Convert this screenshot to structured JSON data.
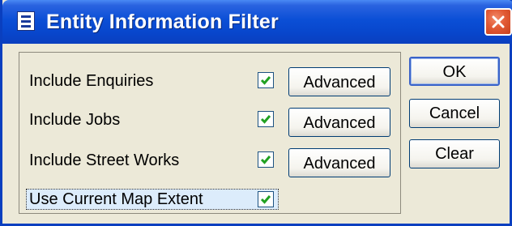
{
  "window": {
    "title": "Entity Information Filter",
    "title_icon": "form-icon",
    "close_icon": "close-icon"
  },
  "filters": [
    {
      "label": "Include Enquiries",
      "checked": true,
      "advanced_label": "Advanced"
    },
    {
      "label": "Include Jobs",
      "checked": true,
      "advanced_label": "Advanced"
    },
    {
      "label": "Include Street Works",
      "checked": true,
      "advanced_label": "Advanced"
    }
  ],
  "map_extent": {
    "label": "Use Current Map Extent",
    "checked": true
  },
  "buttons": {
    "ok": "OK",
    "cancel": "Cancel",
    "clear": "Clear"
  },
  "colors": {
    "titlebar": "#0a3fbf",
    "close": "#e25a35",
    "check": "#21a121",
    "face": "#ece9d8"
  }
}
